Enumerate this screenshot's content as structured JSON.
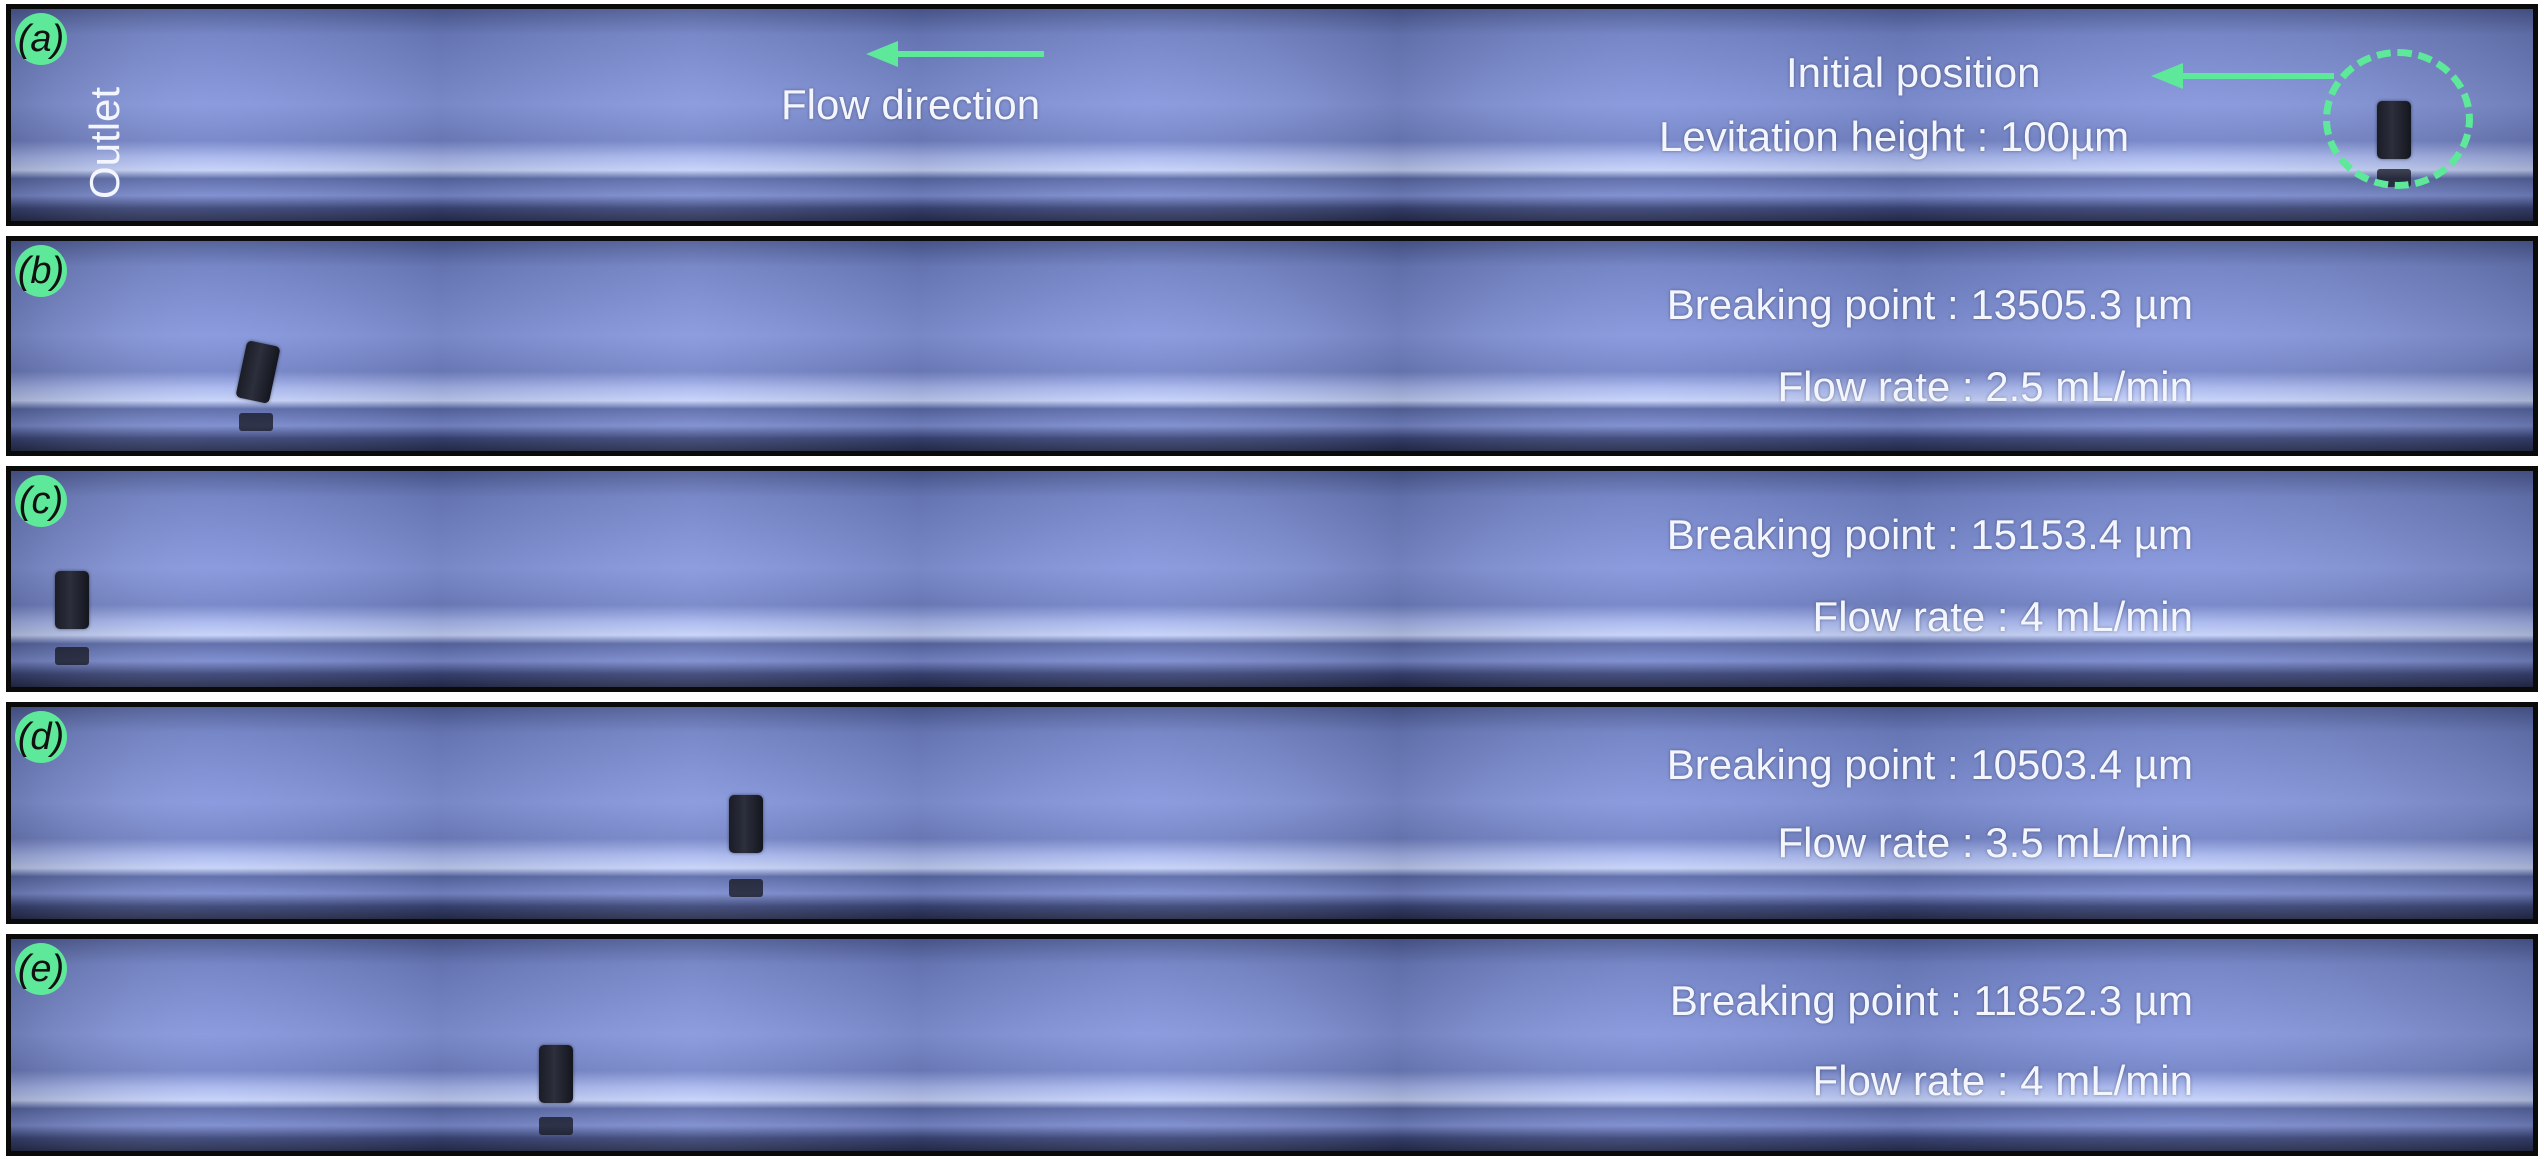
{
  "panels": [
    {
      "label": "a",
      "outlet": "Outlet",
      "flow_direction": "Flow direction",
      "initial_position": "Initial position",
      "levitation_height": "Levitation height : 100µm"
    },
    {
      "label": "b",
      "breaking_point": "Breaking point : 13505.3 µm",
      "flow_rate": "Flow rate : 2.5 mL/min"
    },
    {
      "label": "c",
      "breaking_point": "Breaking point : 15153.4 µm",
      "flow_rate": "Flow rate : 4 mL/min"
    },
    {
      "label": "d",
      "breaking_point": "Breaking point : 10503.4 µm",
      "flow_rate": "Flow rate : 3.5 mL/min"
    },
    {
      "label": "e",
      "breaking_point": "Breaking point : 11852.3 µm",
      "flow_rate": "Flow rate : 4 mL/min"
    }
  ],
  "colors": {
    "channel": "#7f90d8",
    "accent": "#5ee89a",
    "text": "#f4f6ff"
  }
}
